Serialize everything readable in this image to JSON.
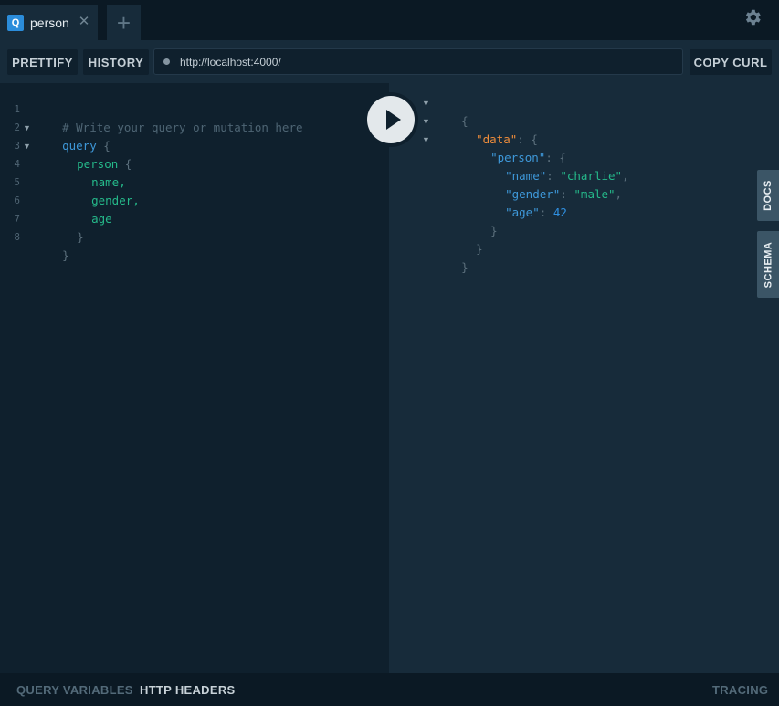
{
  "tabs": [
    {
      "badge": "Q",
      "label": "person",
      "close": "✕"
    }
  ],
  "add_tab_label": "+",
  "toolbar": {
    "prettify_label": "PRETTIFY",
    "history_label": "HISTORY",
    "url": "http://localhost:4000/",
    "copy_curl_label": "COPY CURL"
  },
  "query_editor": {
    "line_numbers": [
      "1",
      "2",
      "3",
      "4",
      "5",
      "6",
      "7",
      "8"
    ],
    "lines": {
      "l1": "# Write your query or mutation here",
      "l2_kw": "query",
      "l2_brace": " {",
      "l3_field": "person",
      "l3_brace": " {",
      "l4": "name,",
      "l5": "gender,",
      "l6": "age",
      "l7": "}",
      "l8": "}"
    }
  },
  "result": {
    "open_brace": "{",
    "data_key": "\"data\"",
    "person_key": "\"person\"",
    "name_key": "\"name\"",
    "name_value": "\"charlie\"",
    "gender_key": "\"gender\"",
    "gender_value": "\"male\"",
    "age_key": "\"age\"",
    "age_value": "42",
    "close_brace": "}"
  },
  "side_tabs": {
    "docs": "DOCS",
    "schema": "SCHEMA"
  },
  "bottom_bar": {
    "query_variables": "QUERY VARIABLES",
    "http_headers": "HTTP HEADERS",
    "tracing": "TRACING"
  },
  "icons": {
    "settings": "gear-icon",
    "run": "play-icon",
    "fold": "caret-down-icon"
  },
  "colors": {
    "background": "#0f202d",
    "panel": "#172b3a",
    "accent": "#2b8ddb",
    "string": "#25b98a",
    "data_key": "#f08d3b"
  }
}
